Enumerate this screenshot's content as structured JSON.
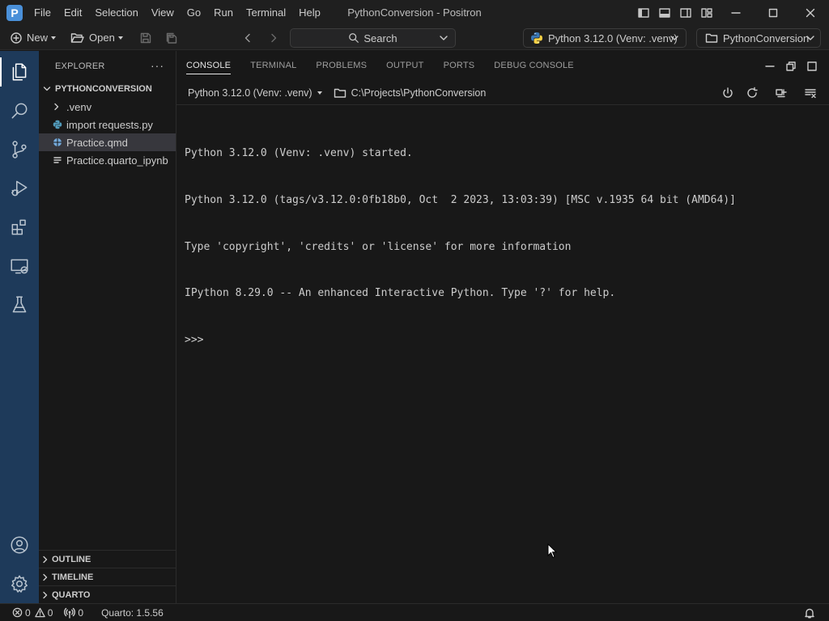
{
  "app": {
    "logo": "P",
    "window_title": "PythonConversion - Positron",
    "menu": [
      "File",
      "Edit",
      "Selection",
      "View",
      "Go",
      "Run",
      "Terminal",
      "Help"
    ]
  },
  "toolbar": {
    "new_label": "New",
    "open_label": "Open",
    "search_label": "Search",
    "interpreter_label": "Python 3.12.0 (Venv: .venv)",
    "folder_label": "PythonConversion"
  },
  "activity_bar": {
    "icons": [
      "explorer-icon",
      "search-icon",
      "source-control-icon",
      "run-debug-icon",
      "extensions-icon",
      "remote-explorer-icon",
      "testing-icon",
      "account-icon",
      "settings-gear-icon"
    ]
  },
  "sidebar": {
    "title": "EXPLORER",
    "more": "···",
    "root_folder": "PYTHONCONVERSION",
    "items": [
      {
        "label": ".venv",
        "icon": "chevron-right-icon"
      },
      {
        "label": "import requests.py",
        "icon": "python-file-icon"
      },
      {
        "label": "Practice.qmd",
        "icon": "quarto-file-icon"
      },
      {
        "label": "Practice.quarto_ipynb",
        "icon": "text-file-icon"
      }
    ],
    "sections": [
      "OUTLINE",
      "TIMELINE",
      "QUARTO"
    ]
  },
  "panel": {
    "tabs": [
      "CONSOLE",
      "TERMINAL",
      "PROBLEMS",
      "OUTPUT",
      "PORTS",
      "DEBUG CONSOLE"
    ],
    "active_tab": "CONSOLE",
    "console_session": "Python 3.12.0 (Venv: .venv)",
    "working_dir": "C:\\Projects\\PythonConversion",
    "output_lines": [
      "Python 3.12.0 (Venv: .venv) started.",
      "Python 3.12.0 (tags/v3.12.0:0fb18b0, Oct  2 2023, 13:03:39) [MSC v.1935 64 bit (AMD64)]",
      "Type 'copyright', 'credits' or 'license' for more information",
      "IPython 8.29.0 -- An enhanced Interactive Python. Type '?' for help.",
      ">>>"
    ]
  },
  "statusbar": {
    "errors": "0",
    "warnings": "0",
    "ports": "0",
    "quarto": "Quarto: 1.5.56"
  },
  "colors": {
    "activity_bar": "#1e3a5a",
    "background": "#181818",
    "chrome": "#1f1f1f",
    "selected_row": "#37373d"
  }
}
